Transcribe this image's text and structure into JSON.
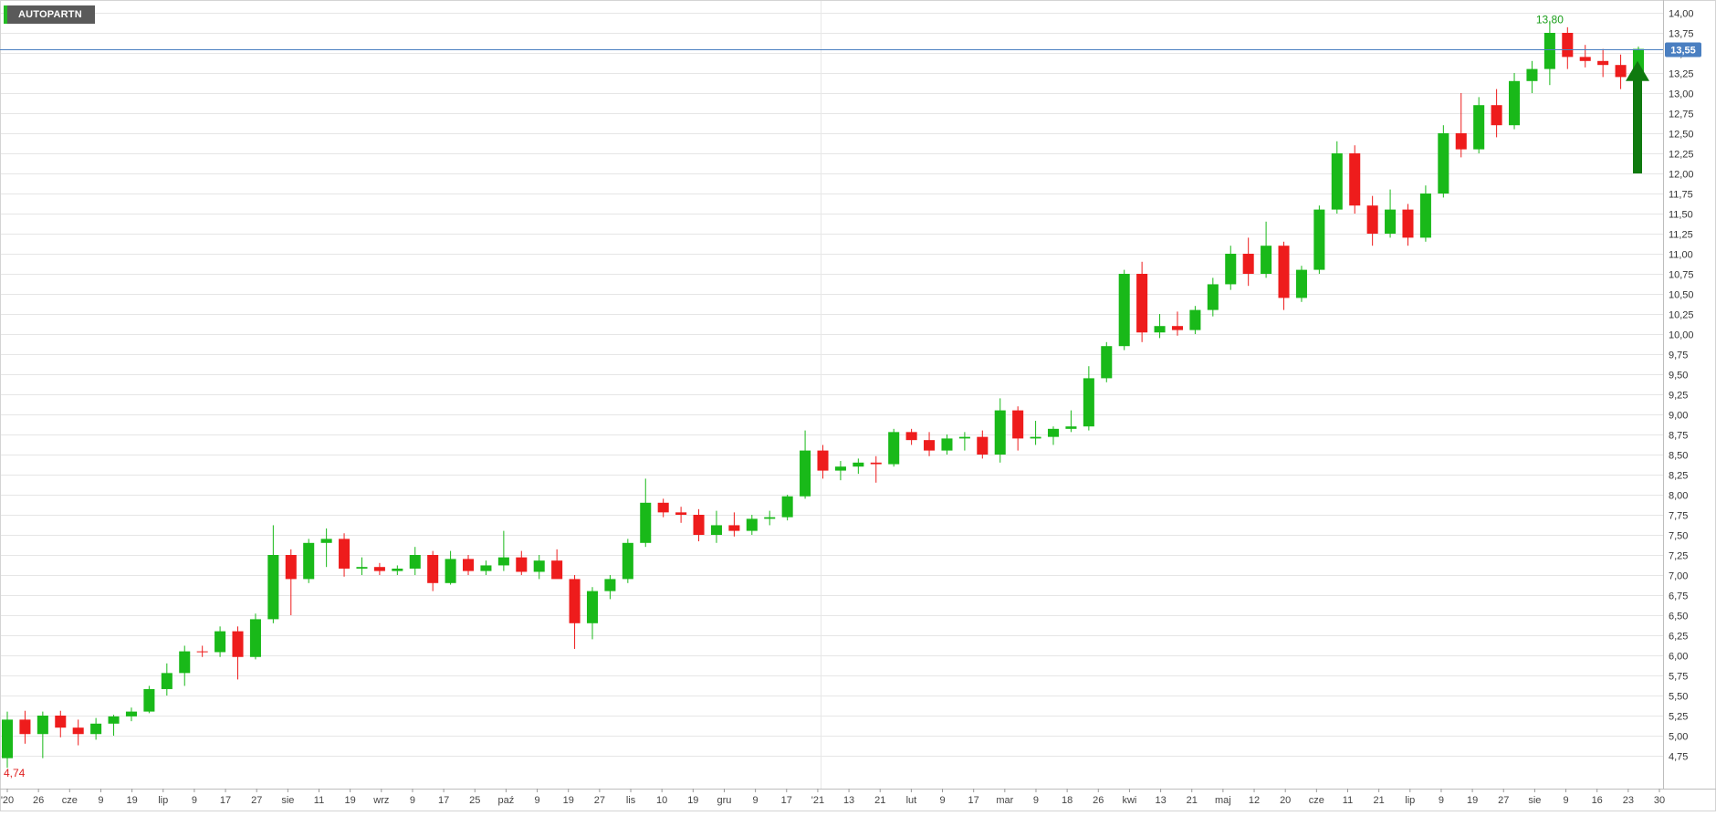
{
  "ticker": "AUTOPARTN",
  "colors": {
    "up": "#19b919",
    "down": "#ee1c1c",
    "grid": "#e6e6e6",
    "current_line": "#4a7fc1",
    "current_badge": "#4a7fc1",
    "arrow": "#0f7a0f",
    "high_label": "#1a9e1a",
    "low_label": "#e02020"
  },
  "chart_data": {
    "type": "candlestick",
    "title": "",
    "xlabel": "",
    "ylabel": "",
    "ylim": [
      4.5,
      14.2
    ],
    "y_ticks": [
      "4,75",
      "5,00",
      "5,25",
      "5,50",
      "5,75",
      "6,00",
      "6,25",
      "6,50",
      "6,75",
      "7,00",
      "7,25",
      "7,50",
      "7,75",
      "8,00",
      "8,25",
      "8,50",
      "8,75",
      "9,00",
      "9,25",
      "9,50",
      "9,75",
      "10,00",
      "10,25",
      "10,50",
      "10,75",
      "11,00",
      "11,25",
      "11,50",
      "11,75",
      "12,00",
      "12,25",
      "12,50",
      "12,75",
      "13,00",
      "13,25",
      "13,50",
      "13,75",
      "14,00"
    ],
    "x_tick_labels": [
      "'20",
      "26",
      "cze",
      "9",
      "19",
      "lip",
      "9",
      "17",
      "27",
      "sie",
      "11",
      "19",
      "wrz",
      "9",
      "17",
      "25",
      "paź",
      "9",
      "19",
      "27",
      "lis",
      "10",
      "19",
      "gru",
      "9",
      "17",
      "'21",
      "13",
      "21",
      "lut",
      "9",
      "17",
      "mar",
      "9",
      "18",
      "26",
      "kwi",
      "13",
      "21",
      "maj",
      "12",
      "20",
      "cze",
      "11",
      "21",
      "lip",
      "9",
      "19",
      "27",
      "sie",
      "9",
      "16",
      "23",
      "30"
    ],
    "current_price": "13,55",
    "current_value": 13.55,
    "high_label": "13,80",
    "high_value": 13.8,
    "low_label": "4,74",
    "low_value": 4.74,
    "grid": true,
    "series": [
      {
        "values": [
          [
            4.72,
            5.3,
            4.6,
            5.2
          ],
          [
            5.2,
            5.31,
            4.9,
            5.02
          ],
          [
            5.02,
            5.3,
            4.72,
            5.25
          ],
          [
            5.25,
            5.31,
            4.98,
            5.1
          ],
          [
            5.1,
            5.2,
            4.88,
            5.02
          ],
          [
            5.02,
            5.22,
            4.95,
            5.15
          ],
          [
            5.15,
            5.26,
            5.0,
            5.24
          ],
          [
            5.24,
            5.35,
            5.18,
            5.3
          ],
          [
            5.3,
            5.62,
            5.28,
            5.58
          ],
          [
            5.58,
            5.9,
            5.5,
            5.78
          ],
          [
            5.78,
            6.12,
            5.62,
            6.05
          ],
          [
            6.05,
            6.12,
            5.98,
            6.04
          ],
          [
            6.04,
            6.36,
            5.98,
            6.3
          ],
          [
            6.3,
            6.36,
            5.7,
            5.98
          ],
          [
            5.98,
            6.52,
            5.95,
            6.45
          ],
          [
            6.45,
            7.62,
            6.4,
            7.25
          ],
          [
            7.25,
            7.32,
            6.5,
            6.95
          ],
          [
            6.95,
            7.45,
            6.9,
            7.4
          ],
          [
            7.4,
            7.58,
            7.1,
            7.45
          ],
          [
            7.45,
            7.52,
            6.98,
            7.08
          ],
          [
            7.08,
            7.22,
            7.0,
            7.1
          ],
          [
            7.1,
            7.15,
            7.0,
            7.05
          ],
          [
            7.05,
            7.12,
            7.0,
            7.08
          ],
          [
            7.08,
            7.35,
            7.0,
            7.25
          ],
          [
            7.25,
            7.3,
            6.8,
            6.9
          ],
          [
            6.9,
            7.3,
            6.88,
            7.2
          ],
          [
            7.2,
            7.25,
            7.0,
            7.05
          ],
          [
            7.05,
            7.18,
            7.0,
            7.12
          ],
          [
            7.12,
            7.55,
            7.05,
            7.22
          ],
          [
            7.22,
            7.3,
            7.0,
            7.04
          ],
          [
            7.04,
            7.25,
            6.95,
            7.18
          ],
          [
            7.18,
            7.32,
            6.98,
            6.95
          ],
          [
            6.95,
            7.0,
            6.08,
            6.4
          ],
          [
            6.4,
            6.85,
            6.2,
            6.8
          ],
          [
            6.8,
            7.0,
            6.7,
            6.95
          ],
          [
            6.95,
            7.45,
            6.9,
            7.4
          ],
          [
            7.4,
            8.2,
            7.35,
            7.9
          ],
          [
            7.9,
            7.95,
            7.72,
            7.78
          ],
          [
            7.78,
            7.85,
            7.65,
            7.75
          ],
          [
            7.75,
            7.82,
            7.42,
            7.5
          ],
          [
            7.5,
            7.8,
            7.4,
            7.62
          ],
          [
            7.62,
            7.78,
            7.48,
            7.55
          ],
          [
            7.55,
            7.75,
            7.5,
            7.7
          ],
          [
            7.7,
            7.8,
            7.62,
            7.72
          ],
          [
            7.72,
            8.0,
            7.68,
            7.98
          ],
          [
            7.98,
            8.8,
            7.95,
            8.55
          ],
          [
            8.55,
            8.62,
            8.2,
            8.3
          ],
          [
            8.3,
            8.42,
            8.18,
            8.35
          ],
          [
            8.35,
            8.45,
            8.26,
            8.4
          ],
          [
            8.4,
            8.48,
            8.15,
            8.38
          ],
          [
            8.38,
            8.82,
            8.35,
            8.78
          ],
          [
            8.78,
            8.82,
            8.62,
            8.68
          ],
          [
            8.68,
            8.78,
            8.48,
            8.55
          ],
          [
            8.55,
            8.75,
            8.5,
            8.7
          ],
          [
            8.7,
            8.78,
            8.55,
            8.72
          ],
          [
            8.72,
            8.8,
            8.45,
            8.5
          ],
          [
            8.5,
            9.2,
            8.4,
            9.05
          ],
          [
            9.05,
            9.1,
            8.55,
            8.7
          ],
          [
            8.7,
            8.92,
            8.62,
            8.72
          ],
          [
            8.72,
            8.85,
            8.62,
            8.82
          ],
          [
            8.82,
            9.05,
            8.78,
            8.85
          ],
          [
            8.85,
            9.6,
            8.8,
            9.45
          ],
          [
            9.45,
            9.9,
            9.4,
            9.85
          ],
          [
            9.85,
            10.8,
            9.8,
            10.75
          ],
          [
            10.75,
            10.9,
            9.9,
            10.02
          ],
          [
            10.02,
            10.25,
            9.95,
            10.1
          ],
          [
            10.1,
            10.28,
            9.98,
            10.05
          ],
          [
            10.05,
            10.35,
            10.0,
            10.3
          ],
          [
            10.3,
            10.7,
            10.22,
            10.62
          ],
          [
            10.62,
            11.1,
            10.55,
            11.0
          ],
          [
            11.0,
            11.2,
            10.6,
            10.75
          ],
          [
            10.75,
            11.4,
            10.7,
            11.1
          ],
          [
            11.1,
            11.15,
            10.3,
            10.45
          ],
          [
            10.45,
            10.85,
            10.4,
            10.8
          ],
          [
            10.8,
            11.6,
            10.75,
            11.55
          ],
          [
            11.55,
            12.4,
            11.5,
            12.25
          ],
          [
            12.25,
            12.35,
            11.5,
            11.6
          ],
          [
            11.6,
            11.72,
            11.1,
            11.25
          ],
          [
            11.25,
            11.8,
            11.2,
            11.55
          ],
          [
            11.55,
            11.62,
            11.1,
            11.2
          ],
          [
            11.2,
            11.85,
            11.15,
            11.75
          ],
          [
            11.75,
            12.6,
            11.7,
            12.5
          ],
          [
            12.5,
            13.0,
            12.2,
            12.3
          ],
          [
            12.3,
            12.95,
            12.25,
            12.85
          ],
          [
            12.85,
            13.05,
            12.45,
            12.6
          ],
          [
            12.6,
            13.25,
            12.55,
            13.15
          ],
          [
            13.15,
            13.4,
            13.0,
            13.3
          ],
          [
            13.3,
            13.9,
            13.1,
            13.75
          ],
          [
            13.75,
            13.82,
            13.3,
            13.45
          ],
          [
            13.45,
            13.6,
            13.32,
            13.4
          ],
          [
            13.4,
            13.55,
            13.2,
            13.35
          ],
          [
            13.35,
            13.48,
            13.05,
            13.2
          ],
          [
            13.2,
            13.58,
            13.1,
            13.55
          ]
        ]
      }
    ]
  }
}
